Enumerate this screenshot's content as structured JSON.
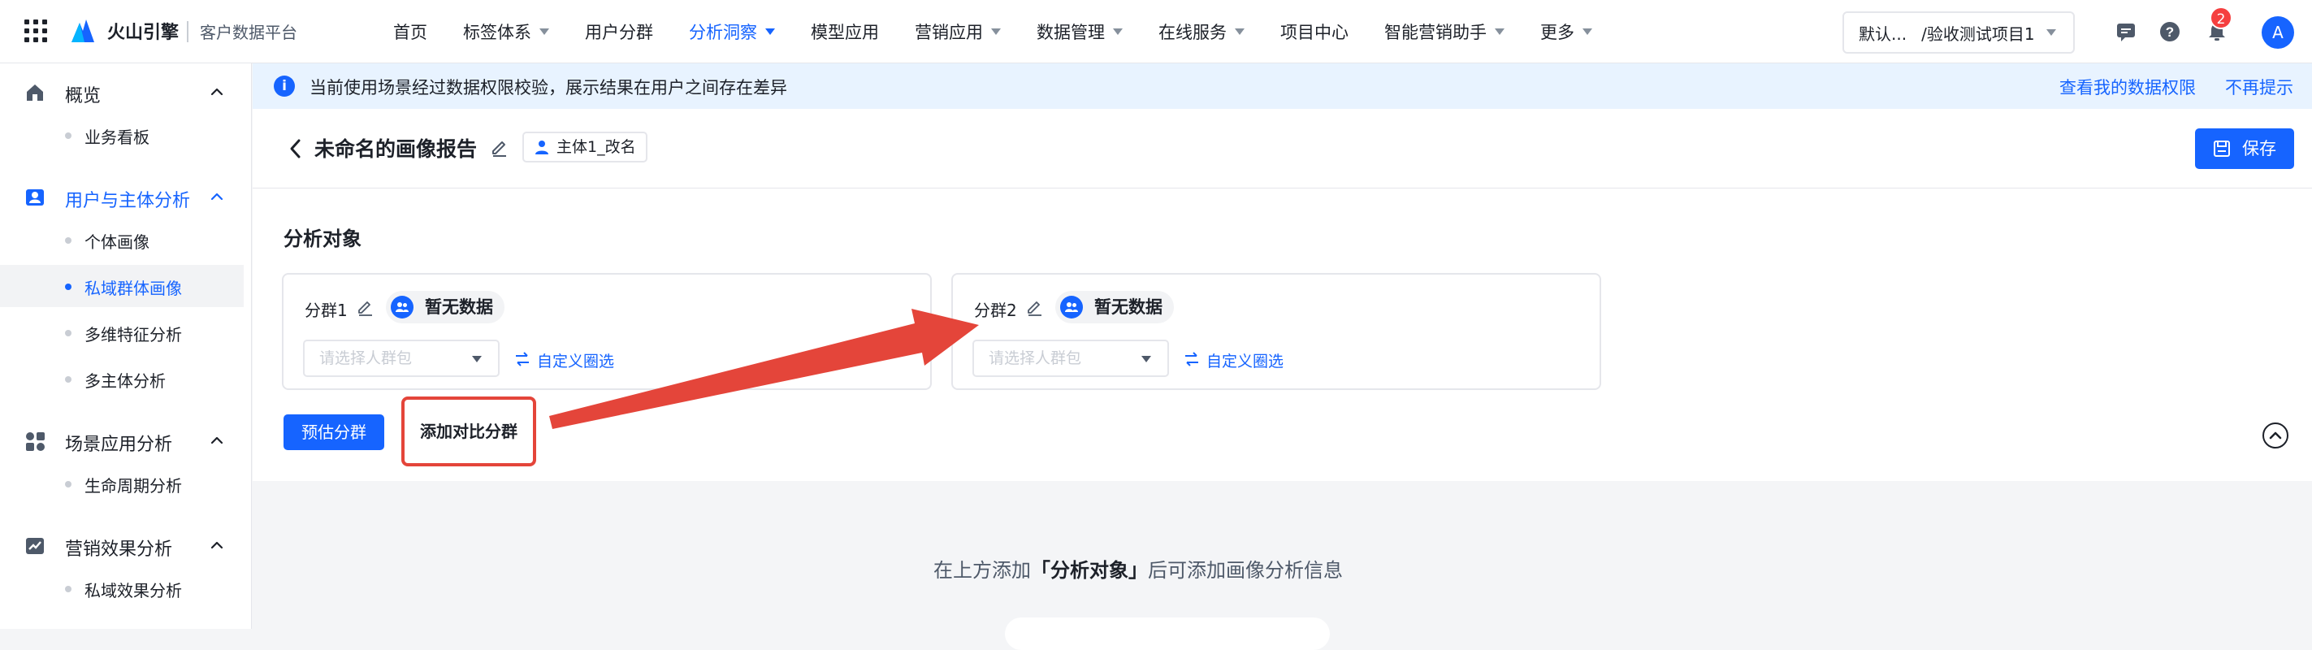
{
  "brand": "火山引擎",
  "product": "客户数据平台",
  "nav": [
    {
      "label": "首页",
      "dropdown": false,
      "active": false
    },
    {
      "label": "标签体系",
      "dropdown": true,
      "active": false
    },
    {
      "label": "用户分群",
      "dropdown": false,
      "active": false
    },
    {
      "label": "分析洞察",
      "dropdown": true,
      "active": true
    },
    {
      "label": "模型应用",
      "dropdown": false,
      "active": false
    },
    {
      "label": "营销应用",
      "dropdown": true,
      "active": false
    },
    {
      "label": "数据管理",
      "dropdown": true,
      "active": false
    },
    {
      "label": "在线服务",
      "dropdown": true,
      "active": false
    },
    {
      "label": "项目中心",
      "dropdown": false,
      "active": false
    },
    {
      "label": "智能营销助手",
      "dropdown": true,
      "active": false
    },
    {
      "label": "更多",
      "dropdown": true,
      "active": false
    }
  ],
  "project_selector": {
    "org": "默认...",
    "project": "/验收测试项目1"
  },
  "notification_count": "2",
  "avatar_initial": "A",
  "sidebar": {
    "groups": [
      {
        "label": "概览",
        "icon": "home-icon",
        "active": false,
        "items": [
          {
            "label": "业务看板",
            "active": false
          }
        ]
      },
      {
        "label": "用户与主体分析",
        "icon": "user-card-icon",
        "active": true,
        "items": [
          {
            "label": "个体画像",
            "active": false
          },
          {
            "label": "私域群体画像",
            "active": true
          },
          {
            "label": "多维特征分析",
            "active": false
          },
          {
            "label": "多主体分析",
            "active": false
          }
        ]
      },
      {
        "label": "场景应用分析",
        "icon": "apps-grid-icon",
        "active": false,
        "items": [
          {
            "label": "生命周期分析",
            "active": false
          }
        ]
      },
      {
        "label": "营销效果分析",
        "icon": "trend-chart-icon",
        "active": false,
        "items": [
          {
            "label": "私域效果分析",
            "active": false
          }
        ]
      }
    ]
  },
  "banner": {
    "message": "当前使用场景经过数据权限校验，展示结果在用户之间存在差异",
    "link_view_permission": "查看我的数据权限",
    "link_dismiss": "不再提示"
  },
  "report": {
    "title": "未命名的画像报告",
    "subject_tag": "主体1_改名",
    "save_label": "保存"
  },
  "analysis": {
    "section_title": "分析对象",
    "groups": [
      {
        "name": "分群1",
        "status": "暂无数据",
        "placeholder": "请选择人群包",
        "custom_label": "自定义圈选"
      },
      {
        "name": "分群2",
        "status": "暂无数据",
        "placeholder": "请选择人群包",
        "custom_label": "自定义圈选"
      }
    ],
    "estimate_label": "预估分群",
    "add_compare_label": "添加对比分群"
  },
  "empty_state": {
    "prefix": "在上方添加",
    "highlight": "「分析对象」",
    "suffix": "后可添加画像分析信息"
  },
  "colors": {
    "accent": "#1664ff",
    "annotation": "#e4453a"
  }
}
